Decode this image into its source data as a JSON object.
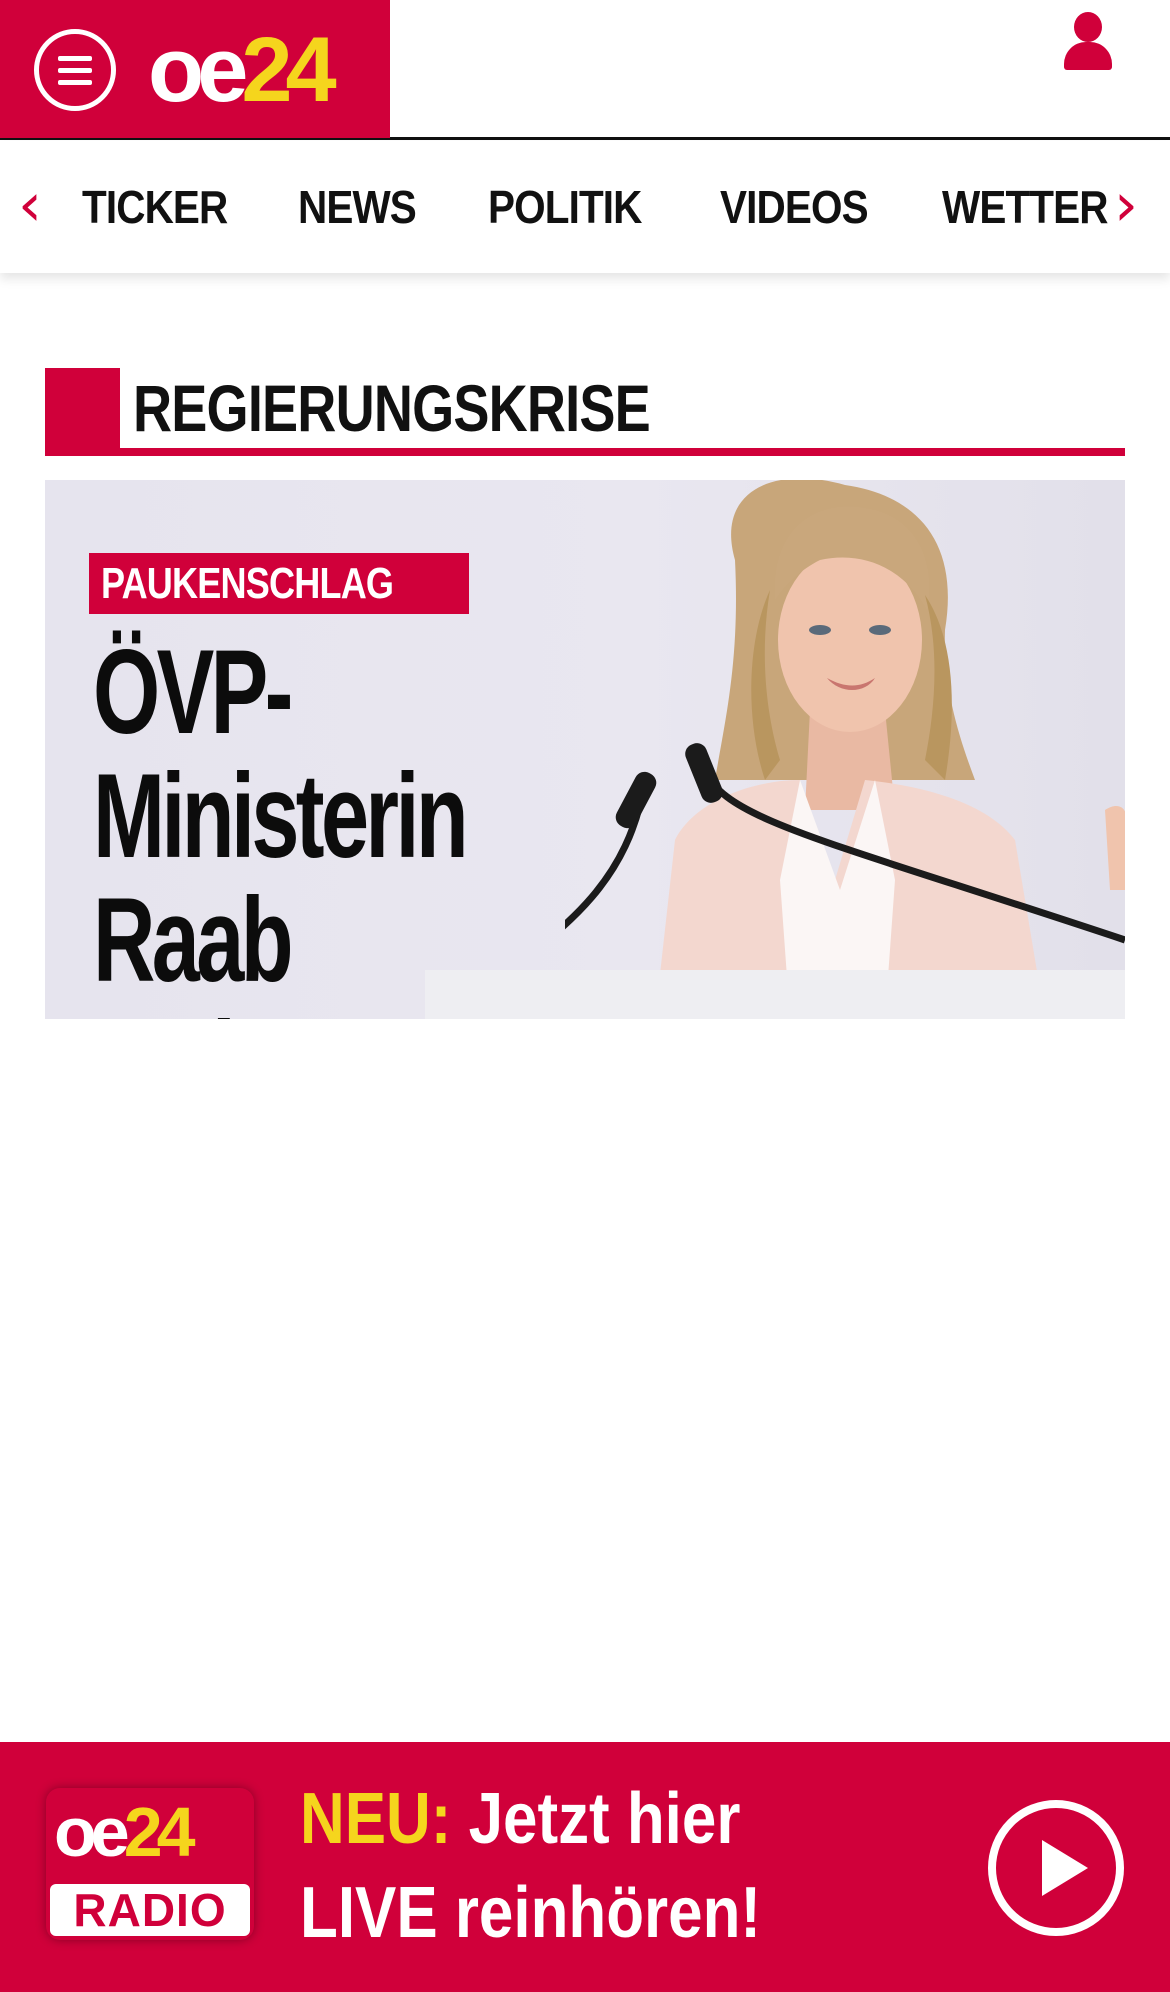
{
  "header": {
    "menu_icon": "hamburger-menu-icon",
    "logo": {
      "part1": "oe",
      "part2": "24"
    },
    "user_icon": "user-account-icon",
    "colors": {
      "brand": "#d0003a",
      "logo_accent": "#f5d51d"
    }
  },
  "nav": {
    "prev_arrow": "‹",
    "next_arrow": "›",
    "items": [
      {
        "label": "TICKER"
      },
      {
        "label": "NEWS"
      },
      {
        "label": "POLITIK"
      },
      {
        "label": "VIDEOS"
      },
      {
        "label": "WETTER"
      }
    ]
  },
  "section": {
    "title": "REGIERUNGSKRISE"
  },
  "article": {
    "kicker": "PAUKENSCHLAG",
    "headline": "ÖVP-Ministerin\nRaab verlässt\ndie Politik",
    "image": "woman-speaking-at-podium-photo"
  },
  "radio_banner": {
    "logo": {
      "part1": "oe",
      "part2": "24",
      "label": "RADIO"
    },
    "neu": "NEU:",
    "line1": "Jetzt hier",
    "line2": "LIVE reinhören!",
    "play_icon": "play-icon"
  }
}
